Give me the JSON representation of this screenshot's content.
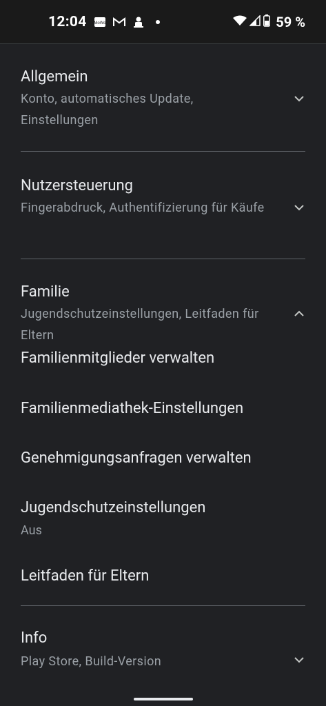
{
  "status_bar": {
    "time": "12:04",
    "battery": "59 %",
    "notification_icons": [
      "mowo-icon",
      "gmail-icon",
      "bot-icon"
    ]
  },
  "sections": {
    "allgemein": {
      "title": "Allgemein",
      "subtitle": "Konto, automatisches Update, Einstellungen"
    },
    "nutzersteuerung": {
      "title": "Nutzersteuerung",
      "subtitle": "Fingerabdruck, Authentifizierung für Käufe"
    },
    "familie": {
      "title": "Familie",
      "subtitle": "Jugendschutzeinstellungen, Leitfaden für Eltern",
      "items": [
        {
          "title": "Familienmitglieder verwalten"
        },
        {
          "title": "Familienmediathek-Einstellungen"
        },
        {
          "title": "Genehmigungsanfragen verwalten"
        },
        {
          "title": "Jugendschutzeinstellungen",
          "subtitle": "Aus"
        },
        {
          "title": "Leitfaden für Eltern"
        }
      ]
    },
    "info": {
      "title": "Info",
      "subtitle": "Play Store, Build-Version"
    }
  },
  "colors": {
    "background": "#202124",
    "text_primary": "#e8eaed",
    "text_secondary": "#9aa0a6",
    "divider": "#5f6368"
  }
}
